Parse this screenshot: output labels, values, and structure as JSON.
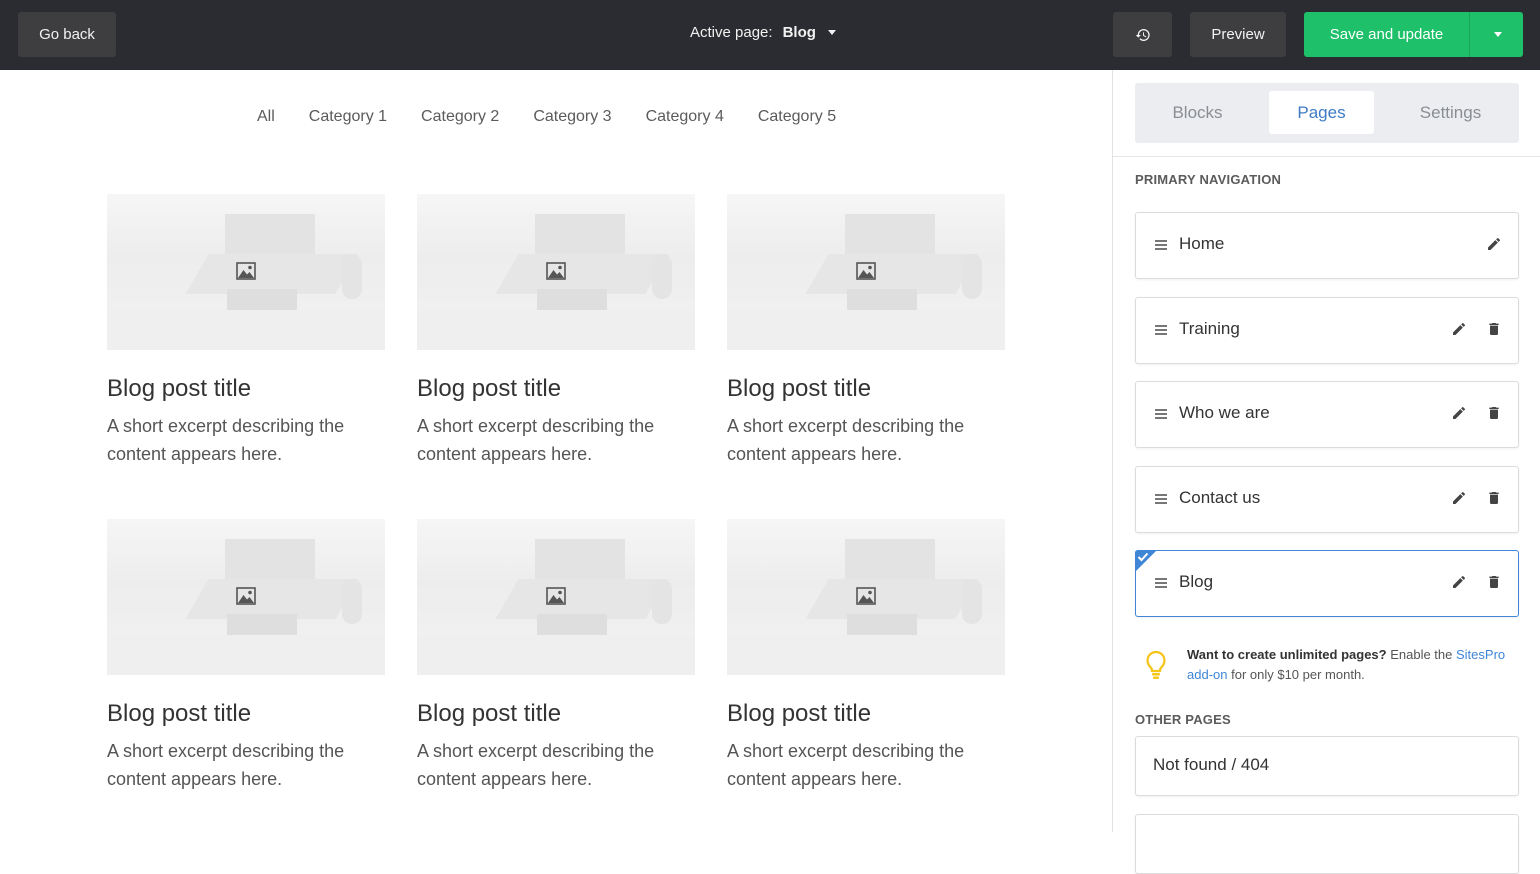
{
  "topbar": {
    "go_back": "Go back",
    "active_page_label": "Active page:",
    "active_page_value": "Blog",
    "history_icon": "history-icon",
    "preview": "Preview",
    "save": "Save and update",
    "save_dropdown_icon": "caret-down-icon"
  },
  "canvas": {
    "categories": [
      "All",
      "Category 1",
      "Category 2",
      "Category 3",
      "Category 4",
      "Category 5"
    ],
    "posts": [
      {
        "title": "Blog post title",
        "excerpt": "A short excerpt describing the content appears here."
      },
      {
        "title": "Blog post title",
        "excerpt": "A short excerpt describing the content appears here."
      },
      {
        "title": "Blog post title",
        "excerpt": "A short excerpt describing the content appears here."
      },
      {
        "title": "Blog post title",
        "excerpt": "A short excerpt describing the content appears here."
      },
      {
        "title": "Blog post title",
        "excerpt": "A short excerpt describing the content appears here."
      },
      {
        "title": "Blog post title",
        "excerpt": "A short excerpt describing the content appears here."
      }
    ]
  },
  "panel": {
    "tabs": [
      {
        "label": "Blocks",
        "active": false
      },
      {
        "label": "Pages",
        "active": true
      },
      {
        "label": "Settings",
        "active": false
      }
    ],
    "primary_heading": "PRIMARY NAVIGATION",
    "primary_pages": [
      {
        "label": "Home",
        "deletable": false,
        "active": false
      },
      {
        "label": "Training",
        "deletable": true,
        "active": false
      },
      {
        "label": "Who we are",
        "deletable": true,
        "active": false
      },
      {
        "label": "Contact us",
        "deletable": true,
        "active": false
      },
      {
        "label": "Blog",
        "deletable": true,
        "active": true
      }
    ],
    "promo": {
      "bold": "Want to create unlimited pages?",
      "text1": " Enable the ",
      "link": "SitesPro add-on",
      "text2": " for only $10 per month."
    },
    "other_heading": "OTHER PAGES",
    "other_pages": [
      {
        "label": "Not found / 404"
      },
      {
        "label": ""
      }
    ]
  },
  "colors": {
    "topbar": "#2b2c31",
    "accent_green": "#1ec06a",
    "accent_blue": "#3f86d6",
    "bulb": "#f5c518"
  }
}
